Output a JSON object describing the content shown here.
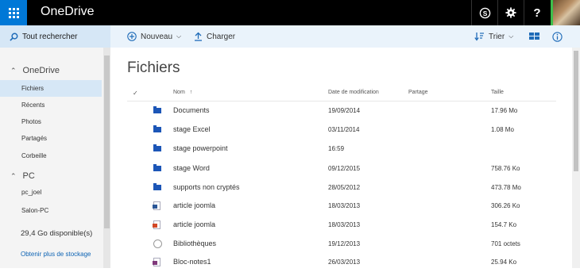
{
  "topbar": {
    "brand": "OneDrive",
    "skype_icon": "skype-icon",
    "settings_icon": "gear-icon",
    "help_label": "?",
    "accent": "#0078d7",
    "status_color": "#3dbe4b"
  },
  "commandbar": {
    "search_label": "Tout rechercher",
    "new_label": "Nouveau",
    "upload_label": "Charger",
    "sort_label": "Trier"
  },
  "sidebar": {
    "onedrive_header": "OneDrive",
    "onedrive_items": [
      {
        "label": "Fichiers",
        "active": true
      },
      {
        "label": "Récents"
      },
      {
        "label": "Photos"
      },
      {
        "label": "Partagés"
      },
      {
        "label": "Corbeille"
      }
    ],
    "pc_header": "PC",
    "pc_items": [
      {
        "label": "pc_joel"
      },
      {
        "label": "Salon-PC"
      }
    ],
    "storage_text": "29,4 Go disponible(s)",
    "storage_link": "Obtenir plus de stockage"
  },
  "main": {
    "title": "Fichiers",
    "columns": {
      "check": "✓",
      "name": "Nom",
      "name_sort": "↑",
      "modified": "Date de modification",
      "sharing": "Partage",
      "size": "Taille"
    },
    "files": [
      {
        "icon": "folder-icon",
        "name": "Documents",
        "modified": "19/09/2014",
        "sharing": "",
        "size": "17.96 Mo"
      },
      {
        "icon": "folder-icon",
        "name": "stage Excel",
        "modified": "03/11/2014",
        "sharing": "",
        "size": "1.08 Mo"
      },
      {
        "icon": "folder-icon",
        "name": "stage powerpoint",
        "modified": "16:59",
        "sharing": "",
        "size": ""
      },
      {
        "icon": "folder-icon",
        "name": "stage Word",
        "modified": "09/12/2015",
        "sharing": "",
        "size": "758.76 Ko"
      },
      {
        "icon": "folder-icon",
        "name": "supports non cryptés",
        "modified": "28/05/2012",
        "sharing": "",
        "size": "473.78 Mo"
      },
      {
        "icon": "word-doc-icon",
        "name": "article joomla",
        "modified": "18/03/2013",
        "sharing": "",
        "size": "306.26 Ko"
      },
      {
        "icon": "pdf-doc-icon",
        "name": "article joomla",
        "modified": "18/03/2013",
        "sharing": "",
        "size": "154.7 Ko"
      },
      {
        "icon": "globe-icon",
        "name": "Bibliothèques",
        "modified": "19/12/2013",
        "sharing": "",
        "size": "701 octets"
      },
      {
        "icon": "onenote-doc-icon",
        "name": "Bloc-notes1",
        "modified": "26/03/2013",
        "sharing": "",
        "size": "25.94 Ko"
      }
    ]
  }
}
